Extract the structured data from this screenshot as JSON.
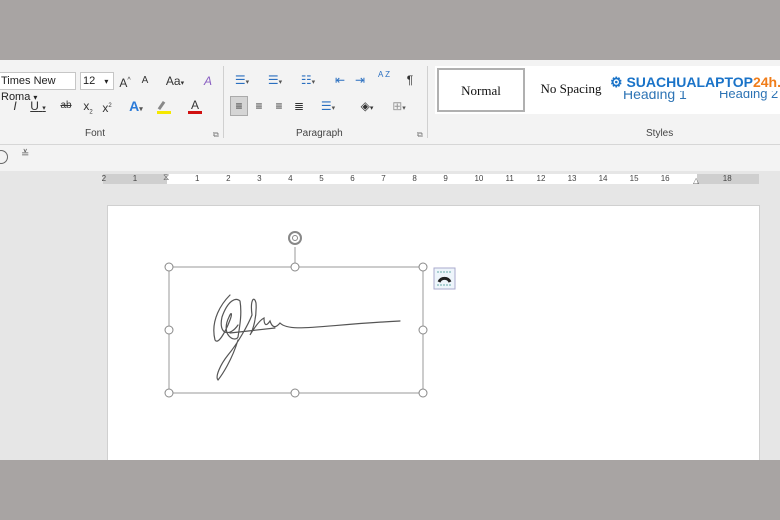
{
  "ribbon": {
    "font": {
      "name": "Times New Roma",
      "size": "12",
      "group_label": "Font",
      "grow_icon": "A^",
      "shrink_icon": "A",
      "change_case": "Aa",
      "clear_format_icon": "A",
      "italic": "I",
      "underline": "U",
      "strike": "ab",
      "subscript": "x",
      "superscript": "x",
      "text_effects": "A",
      "highlight_color": "#f5e800",
      "font_color_label": "A",
      "font_color": "#d01010"
    },
    "paragraph": {
      "group_label": "Paragraph",
      "pilcrow": "¶",
      "sort": "A Z"
    },
    "styles": {
      "group_label": "Styles",
      "items": [
        {
          "label": "Normal",
          "selected": true
        },
        {
          "label": "No Spacing"
        },
        {
          "label": "Heading 1"
        },
        {
          "label": "Heading 2"
        }
      ]
    }
  },
  "watermark": {
    "text": "SUACHUALAPTOP",
    "accent": "24h.com",
    "color": "#1a73c8",
    "accent_color": "#f07d1a"
  },
  "ruler": {
    "left_labels": [
      "2",
      "1"
    ],
    "labels": [
      "1",
      "2",
      "3",
      "4",
      "5",
      "6",
      "7",
      "8",
      "9",
      "10",
      "11",
      "12",
      "13",
      "14",
      "15",
      "16",
      "18"
    ]
  },
  "qat": {
    "redo_icon": "redo",
    "customize_icon": "customize"
  }
}
